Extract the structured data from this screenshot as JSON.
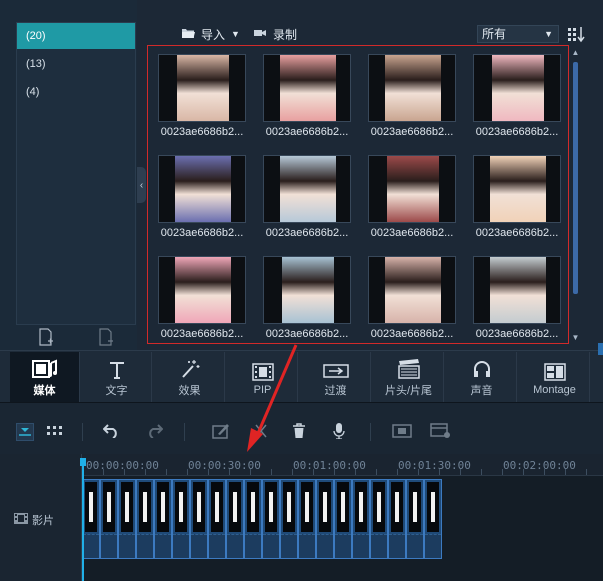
{
  "folders": [
    {
      "label": "(20)",
      "active": true
    },
    {
      "label": "(13)",
      "active": false
    },
    {
      "label": "(4)",
      "active": false
    }
  ],
  "toolbar": {
    "import_label": "导入",
    "record_label": "录制",
    "filter_value": "所有"
  },
  "library": {
    "items": [
      {
        "label": "0023ae6686b2...",
        "tint": "#d9b7a6"
      },
      {
        "label": "0023ae6686b2...",
        "tint": "#e8a0a0"
      },
      {
        "label": "0023ae6686b2...",
        "tint": "#c9a590"
      },
      {
        "label": "0023ae6686b2...",
        "tint": "#f0b8c0"
      },
      {
        "label": "0023ae6686b2...",
        "tint": "#6b6fb0"
      },
      {
        "label": "0023ae6686b2...",
        "tint": "#b7c9d8"
      },
      {
        "label": "0023ae6686b2...",
        "tint": "#9c4a4a"
      },
      {
        "label": "0023ae6686b2...",
        "tint": "#f1d2b8"
      },
      {
        "label": "0023ae6686b2...",
        "tint": "#f0a7b8"
      },
      {
        "label": "0023ae6686b2...",
        "tint": "#a8c2d3"
      },
      {
        "label": "0023ae6686b2...",
        "tint": "#d7b3aa"
      },
      {
        "label": "0023ae6686b2...",
        "tint": "#c4ccd0"
      }
    ]
  },
  "tabs": [
    {
      "name": "tab-media",
      "label": "媒体",
      "active": true
    },
    {
      "name": "tab-text",
      "label": "文字",
      "active": false
    },
    {
      "name": "tab-effects",
      "label": "效果",
      "active": false
    },
    {
      "name": "tab-pip",
      "label": "PIP",
      "active": false
    },
    {
      "name": "tab-transition",
      "label": "过渡",
      "active": false
    },
    {
      "name": "tab-title",
      "label": "片头/片尾",
      "active": false
    },
    {
      "name": "tab-audio",
      "label": "声音",
      "active": false
    },
    {
      "name": "tab-montage",
      "label": "Montage",
      "active": false
    }
  ],
  "timeline": {
    "ruler": [
      "00:00:00:00",
      "00:00:30:00",
      "00:01:00:00",
      "00:01:30:00",
      "00:02:00:00"
    ],
    "track_label": "影片",
    "clip_count": 20
  },
  "colors": {
    "accent": "#1f9aa5",
    "selection_border": "#d12a2a",
    "playhead": "#20b0e8"
  }
}
